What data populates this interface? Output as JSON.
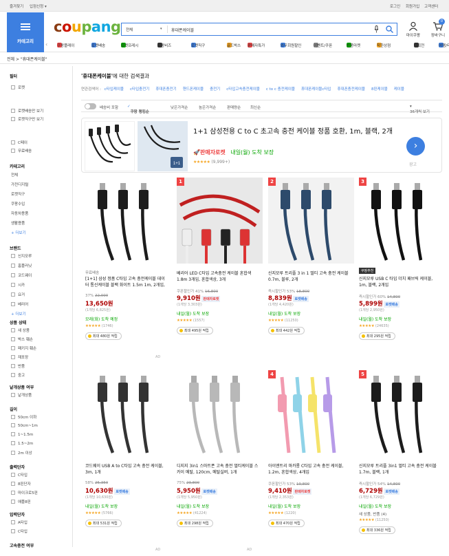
{
  "topbar": {
    "left": [
      "즐겨찾기",
      "입점신청 ▾"
    ],
    "right": [
      "로그인",
      "회원가입",
      "고객센터"
    ]
  },
  "header": {
    "category_label": "카테고리",
    "logo_letters": [
      {
        "ch": "c",
        "color": "#8a3b12"
      },
      {
        "ch": "o",
        "color": "#cb1400"
      },
      {
        "ch": "u",
        "color": "#f2a600"
      },
      {
        "ch": "p",
        "color": "#6cb33f"
      },
      {
        "ch": "a",
        "color": "#11a7e0"
      },
      {
        "ch": "n",
        "color": "#11a7e0"
      },
      {
        "ch": "g",
        "color": "#6cb33f"
      }
    ],
    "search_category": "전체",
    "search_query": "휴대폰케이블",
    "mypage": "마이쿠팡",
    "cart": "장바구니",
    "cart_count": "0",
    "quick_links": [
      "쿠팡플레이",
      "로켓배송",
      "로켓프레시",
      "쿠팡비즈",
      "로켓직구",
      "골드박스",
      "판매자특가",
      "와우회원할인",
      "이벤트/쿠폰",
      "반품마켓",
      "착한상점",
      "기획전",
      "여행/티켓"
    ]
  },
  "breadcrumb": "전체  >  \"휴대폰케이블\"",
  "sidebar": {
    "filter_title": "필터",
    "delivery": [
      "로켓",
      "로켓배송만 보기",
      "로켓직구만 보기",
      "C페이",
      "무료배송"
    ],
    "category_title": "카테고리",
    "categories": [
      "전체",
      "가전디지털",
      "로켓직구",
      "쿠팡수입",
      "자동차용품",
      "생활용품"
    ],
    "more": "+ 더보기",
    "brand_title": "브랜드",
    "brands": [
      "신지모루",
      "홈플러닛",
      "코드웨이",
      "시카",
      "요거",
      "베리어"
    ],
    "condition_title": "상품 상태",
    "conditions": [
      "새 상품",
      "박스 훼손",
      "패키지 훼손",
      "재포장",
      "반품",
      "중고"
    ],
    "unit_title": "낱개상품 여부",
    "unit": [
      "낱개상품"
    ],
    "length_title": "길이",
    "lengths": [
      "50cm 이하",
      "50cm~1m",
      "1~1.5m",
      "1.5~2m",
      "2m 이상"
    ],
    "out_title": "출력단자",
    "outs": [
      "C타입",
      "8핀단자",
      "마이크로5핀",
      "애플8핀"
    ],
    "in_title": "입력단자",
    "ins": [
      "A타입",
      "C타입"
    ],
    "fast_title": "고속충전 여부"
  },
  "main": {
    "title_q": "'휴대폰케이블'",
    "title_rest": "에 대한 검색결과",
    "related_label": "연관검색어 :",
    "related": [
      "c타입케이블",
      "c타입충전기",
      "휴대폰충전기",
      "핸드폰케이블",
      "충전기",
      "c타입고속충전케이블",
      "c to c 충전케이블",
      "휴대폰케이블c타입",
      "휴대폰충전케이블",
      "8핀케이블",
      "케이블"
    ],
    "sort": {
      "toggle": "배송비 포함",
      "rocket": "쿠팡 랭킹순",
      "opts": [
        "낮은가격순",
        "높은가격순",
        "판매량순",
        "최신순"
      ],
      "count": "36개씩 보기"
    }
  },
  "ad": {
    "title": "1+1 삼성전용 C to C 초고속 충전 케이블 정품 호환, 1m, 블랙, 2개",
    "seller": "판매자로켓",
    "delivery": "내일(월) 도착 보장",
    "rating_count": "(9,999+)",
    "ad_label": "광고"
  },
  "products": [
    {
      "rank": "",
      "badge": "",
      "pre": "무료배송",
      "name": "[1+1] 삼성 정품 C타입 고속 충전케이블 데이터 통신케이블 블랙 화이트 1.5m 1m, 2개입, 150cm, 블랙 ( 2개...",
      "discount": "37%",
      "old": "22,000",
      "price": "13,650원",
      "unit": "(1개당 6,825원)",
      "rocket": "",
      "delivery": "모레(화) 도착 예정",
      "reviews": "(1746)",
      "pill": "최대 480원 적립",
      "ad": "AD"
    },
    {
      "rank": "1",
      "badge": "",
      "pre": "",
      "name": "베리어 LED C타입 고속충전 케이블 혼합색 1.8m 3개입, 혼합색상, 3개",
      "discount": "쿠폰할인가 41%",
      "old": "16,800",
      "price": "9,910원",
      "unit": "(1개당 3,303원)",
      "rocket": "판매자로켓",
      "delivery": "내일(월) 도착 보장",
      "reviews": "(1557)",
      "pill": "최대 495원 적립",
      "ad": ""
    },
    {
      "rank": "2",
      "badge": "",
      "pre": "",
      "name": "신지모루 트리플 3 in 1 멀티 고속 충전 케이블 0.7m, 블루, 2개",
      "discount": "즉시할인가 53%",
      "old": "18,800",
      "price": "8,839원",
      "unit": "(1개당 4,420원)",
      "rocket": "로켓배송",
      "delivery": "내일(월) 도착 보장",
      "reviews": "(11250)",
      "pill": "최대 442원 적립",
      "ad": ""
    },
    {
      "rank": "3",
      "badge": "쿠팡추천",
      "pre": "",
      "name": "신지모루 USB C 타입 더치 패브릭 케이블, 1m, 블랙, 2개입",
      "discount": "즉시할인가 60%",
      "old": "14,800",
      "price": "5,899원",
      "unit": "(1개당 2,950원)",
      "rocket": "로켓배송",
      "delivery": "내일(월) 도착 보장",
      "reviews": "(24635)",
      "pill": "최대 295원 적립",
      "ad": ""
    },
    {
      "rank": "",
      "badge": "",
      "pre": "",
      "name": "코드웨이 USB A to C타입 고속 충전 케이블, 3m, 1개",
      "discount": "58%",
      "old": "25,350",
      "price": "10,630원",
      "unit": "(1개당 10,630원)",
      "rocket": "로켓배송",
      "delivery": "내일(월) 도착 보장",
      "reviews": "(5766)",
      "pill": "최대 531원 적립",
      "ad": "AD"
    },
    {
      "rank": "",
      "badge": "",
      "pre": "",
      "name": "디지지 3in1 스마트폰 고속 충전 멀티케이블 스카이 메탈, 120cm, 메탈실버, 1개",
      "discount": "75%",
      "old": "23,800",
      "price": "5,950원",
      "unit": "(1개당 5,950원)",
      "rocket": "로켓배송",
      "delivery": "내일(월) 도착 보장",
      "reviews": "(41224)",
      "pill": "최대 298원 적립",
      "ad": "AD"
    },
    {
      "rank": "4",
      "badge": "",
      "pre": "",
      "name": "아이엔트리 마카롱 C타입 고속 충전 케이블, 1.2m, 혼합색상, 4개입",
      "discount": "쿠폰할인가 53%",
      "old": "19,800",
      "price": "9,410원",
      "unit": "(1개당 2,353원)",
      "rocket": "판매자로켓",
      "delivery": "내일(월) 도착 보장",
      "reviews": "(1220)",
      "pill": "최대 470원 적립",
      "ad": ""
    },
    {
      "rank": "5",
      "badge": "",
      "pre": "",
      "name": "신지모루 트리플 3in1 멀티 고속 충전 케이블 1.7m, 블랙, 1개",
      "discount": "즉시할인가 54%",
      "old": "14,800",
      "price": "6,729원",
      "unit": "(1개당 6,729원)",
      "rocket": "로켓배송",
      "delivery": "내일(월) 도착 보장",
      "reviews": "(11250)",
      "pill": "최대 336원 적립",
      "extra": "새 상품, 반품 (4)",
      "ad": ""
    }
  ]
}
